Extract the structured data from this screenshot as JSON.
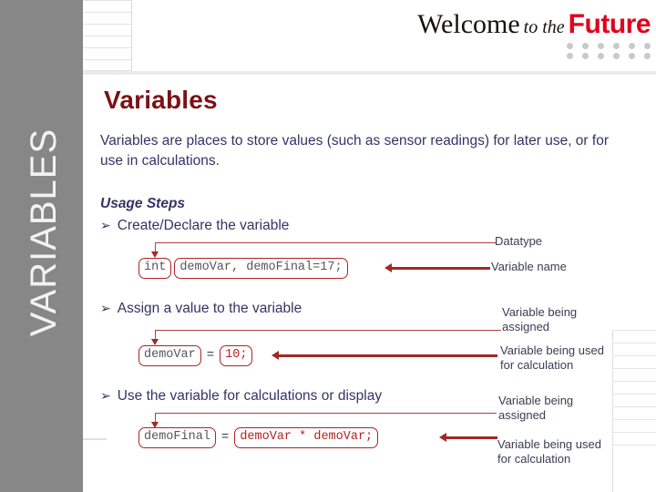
{
  "logo": {
    "welcome": "Welcome",
    "to_the": "to the",
    "future": "Future",
    "dot_rows": 2,
    "dot_cols": 6,
    "dot_color": "#c9c9c9",
    "future_color": "#e2001a"
  },
  "sidebar": {
    "label": "VARIABLES",
    "bg_color": "#878787",
    "text_color": "#f2f2f2"
  },
  "slide": {
    "title": "Variables",
    "title_color": "#7d1116",
    "body_color": "#333366",
    "accent_color": "#a52727",
    "intro": "Variables are places to store values (such as sensor readings) for later use, or for use in calculations.",
    "usage_heading": "Usage Steps",
    "bullet_glyph": "➢",
    "bullets": [
      {
        "label": "Create/Declare the variable"
      },
      {
        "label": "Assign a value to the variable"
      },
      {
        "label": "Use the variable for calculations or display"
      }
    ]
  },
  "code_blocks": [
    {
      "id": "declare",
      "parts": [
        {
          "text": "int",
          "style": "gray"
        },
        {
          "text": "demoVar, demoFinal=17;",
          "style": "gray"
        }
      ]
    },
    {
      "id": "assign",
      "parts": [
        {
          "text": "demoVar",
          "style": "gray"
        },
        {
          "text": "=",
          "style": "operator"
        },
        {
          "text": "10;",
          "style": "red"
        }
      ]
    },
    {
      "id": "calculate",
      "parts": [
        {
          "text": "demoFinal",
          "style": "gray"
        },
        {
          "text": "=",
          "style": "operator"
        },
        {
          "text": "demoVar * demoVar;",
          "style": "red"
        }
      ]
    }
  ],
  "annotations": [
    {
      "id": "datatype",
      "text": "Datatype"
    },
    {
      "id": "variable-name",
      "text": "Variable name"
    },
    {
      "id": "assigned-1-line1",
      "text": "Variable being"
    },
    {
      "id": "assigned-1-line2",
      "text": "assigned"
    },
    {
      "id": "used-1-line1",
      "text": "Variable being used"
    },
    {
      "id": "used-1-line2",
      "text": "for calculation"
    },
    {
      "id": "assigned-2-line1",
      "text": "Variable being"
    },
    {
      "id": "assigned-2-line2",
      "text": "assigned"
    },
    {
      "id": "used-2-line1",
      "text": "Variable being used"
    },
    {
      "id": "used-2-line2",
      "text": "for calculation"
    }
  ]
}
